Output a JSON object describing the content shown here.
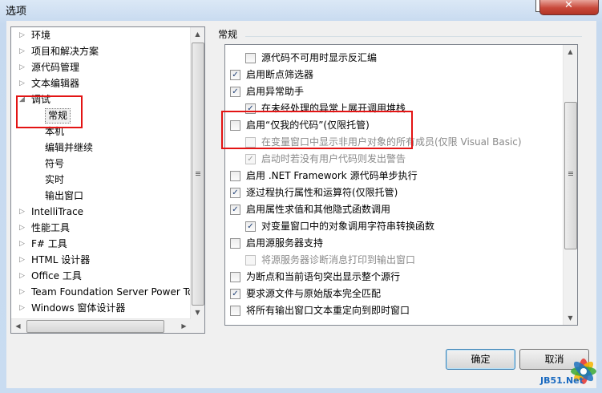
{
  "window": {
    "title": "选项",
    "close_glyph": "✕"
  },
  "tree": {
    "items": [
      {
        "label": "环境",
        "expandable": true
      },
      {
        "label": "项目和解决方案",
        "expandable": true
      },
      {
        "label": "源代码管理",
        "expandable": true
      },
      {
        "label": "文本编辑器",
        "expandable": true
      },
      {
        "label": "调试",
        "expanded": true
      },
      {
        "label": "常规",
        "child": true,
        "selected": true
      },
      {
        "label": "本机",
        "child": true
      },
      {
        "label": "编辑并继续",
        "child": true
      },
      {
        "label": "符号",
        "child": true
      },
      {
        "label": "实时",
        "child": true
      },
      {
        "label": "输出窗口",
        "child": true
      },
      {
        "label": "IntelliTrace",
        "expandable": true
      },
      {
        "label": "性能工具",
        "expandable": true
      },
      {
        "label": "F# 工具",
        "expandable": true
      },
      {
        "label": "HTML 设计器",
        "expandable": true
      },
      {
        "label": "Office 工具",
        "expandable": true
      },
      {
        "label": "Team Foundation Server Power Tools",
        "expandable": true
      },
      {
        "label": "Windows 窗体设计器",
        "expandable": true
      }
    ]
  },
  "section": {
    "title": "常规"
  },
  "options": [
    {
      "label": "源代码不可用时显示反汇编",
      "checked": false,
      "indent": 1,
      "disabled": false
    },
    {
      "label": "启用断点筛选器",
      "checked": true,
      "indent": 0,
      "disabled": false
    },
    {
      "label": "启用异常助手",
      "checked": true,
      "indent": 0,
      "disabled": false
    },
    {
      "label": "在未经处理的异常上展开调用堆栈",
      "checked": true,
      "indent": 1,
      "disabled": false
    },
    {
      "label": "启用“仅我的代码”(仅限托管)",
      "checked": false,
      "indent": 0,
      "disabled": false
    },
    {
      "label": "在变量窗口中显示非用户对象的所有成员(仅限 Visual Basic)",
      "checked": false,
      "indent": 1,
      "disabled": true
    },
    {
      "label": "启动时若没有用户代码则发出警告",
      "checked": true,
      "indent": 1,
      "disabled": true
    },
    {
      "label": "启用 .NET Framework 源代码单步执行",
      "checked": false,
      "indent": 0,
      "disabled": false
    },
    {
      "label": "逐过程执行属性和运算符(仅限托管)",
      "checked": true,
      "indent": 0,
      "disabled": false
    },
    {
      "label": "启用属性求值和其他隐式函数调用",
      "checked": true,
      "indent": 0,
      "disabled": false
    },
    {
      "label": "对变量窗口中的对象调用字符串转换函数",
      "checked": true,
      "indent": 1,
      "disabled": false
    },
    {
      "label": "启用源服务器支持",
      "checked": false,
      "indent": 0,
      "disabled": false
    },
    {
      "label": "将源服务器诊断消息打印到输出窗口",
      "checked": false,
      "indent": 1,
      "disabled": true
    },
    {
      "label": "为断点和当前语句突出显示整个源行",
      "checked": false,
      "indent": 0,
      "disabled": false
    },
    {
      "label": "要求源文件与原始版本完全匹配",
      "checked": true,
      "indent": 0,
      "disabled": false
    },
    {
      "label": "将所有输出窗口文本重定向到即时窗口",
      "checked": false,
      "indent": 0,
      "disabled": false
    }
  ],
  "buttons": {
    "ok": "确定",
    "cancel": "取消"
  },
  "watermark": {
    "text": "JB51.Net"
  },
  "colors": {
    "highlight_box": "#e31414",
    "check_mark": "#1c3d74"
  }
}
